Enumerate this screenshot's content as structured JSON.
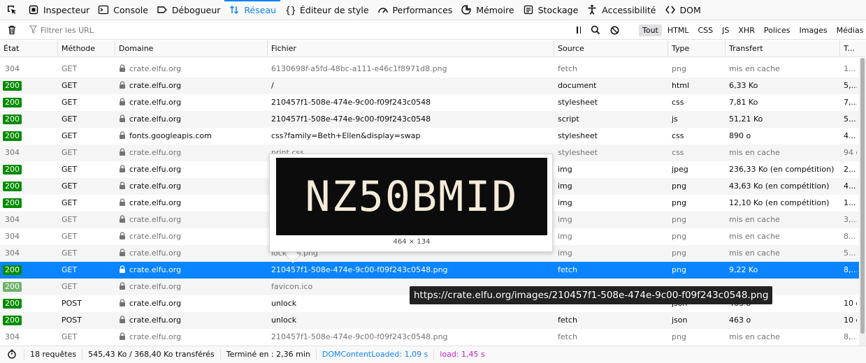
{
  "toolbar": {
    "tabs": [
      {
        "label": "Inspecteur",
        "icon": "inspector-icon"
      },
      {
        "label": "Console",
        "icon": "console-icon"
      },
      {
        "label": "Débogueur",
        "icon": "debugger-icon"
      },
      {
        "label": "Réseau",
        "icon": "network-icon",
        "active": true
      },
      {
        "label": "Éditeur de style",
        "icon": "style-editor-icon"
      },
      {
        "label": "Performances",
        "icon": "performance-icon"
      },
      {
        "label": "Mémoire",
        "icon": "memory-icon"
      },
      {
        "label": "Stockage",
        "icon": "storage-icon"
      },
      {
        "label": "Accessibilité",
        "icon": "accessibility-icon"
      },
      {
        "label": "DOM",
        "icon": "dom-icon"
      }
    ]
  },
  "filter": {
    "placeholder": "Filtrer les URL",
    "types": [
      "Tout",
      "HTML",
      "CSS",
      "JS",
      "XHR",
      "Polices",
      "Images",
      "Médias"
    ],
    "active_type": "Tout"
  },
  "columns": [
    "État",
    "Méthode",
    "Domaine",
    "Fichier",
    "Source",
    "Type",
    "Transfert",
    "T..."
  ],
  "rows": [
    {
      "status": "304",
      "method": "GET",
      "domain": "crate.elfu.org",
      "file": "6130698f-a5fd-48bc-a111-e46c1f8971d8.png",
      "source": "fetch",
      "type": "png",
      "transfer": "mis en cache",
      "size": "1...",
      "cached": true
    },
    {
      "status": "200",
      "method": "GET",
      "domain": "crate.elfu.org",
      "file": "/",
      "source": "document",
      "type": "html",
      "transfer": "6,33 Ko",
      "size": "5,...",
      "cached": false
    },
    {
      "status": "200",
      "method": "GET",
      "domain": "crate.elfu.org",
      "file": "210457f1-508e-474e-9c00-f09f243c0548",
      "source": "stylesheet",
      "type": "css",
      "transfer": "7,81 Ko",
      "size": "7,...",
      "cached": false
    },
    {
      "status": "200",
      "method": "GET",
      "domain": "crate.elfu.org",
      "file": "210457f1-508e-474e-9c00-f09f243c0548",
      "source": "script",
      "type": "js",
      "transfer": "51,21 Ko",
      "size": "5...",
      "cached": false
    },
    {
      "status": "200",
      "method": "GET",
      "domain": "fonts.googleapis.com",
      "file": "css?family=Beth+Ellen&display=swap",
      "source": "stylesheet",
      "type": "css",
      "transfer": "890 o",
      "size": "4...",
      "cached": false
    },
    {
      "status": "304",
      "method": "GET",
      "domain": "crate.elfu.org",
      "file": "print.css",
      "source": "stylesheet",
      "type": "css",
      "transfer": "mis en cache",
      "size": "94 o",
      "cached": true
    },
    {
      "status": "200",
      "method": "GET",
      "domain": "crate.elfu.org",
      "file": "",
      "source": "img",
      "type": "jpeg",
      "transfer": "236,33 Ko (en compétition)",
      "size": "2...",
      "cached": false
    },
    {
      "status": "200",
      "method": "GET",
      "domain": "crate.elfu.org",
      "file": "",
      "source": "img",
      "type": "png",
      "transfer": "43,63 Ko (en compétition)",
      "size": "4...",
      "cached": false
    },
    {
      "status": "200",
      "method": "GET",
      "domain": "crate.elfu.org",
      "file": "",
      "source": "img",
      "type": "png",
      "transfer": "12,10 Ko (en compétition)",
      "size": "1...",
      "cached": false
    },
    {
      "status": "304",
      "method": "GET",
      "domain": "crate.elfu.org",
      "file": "",
      "source": "img",
      "type": "png",
      "transfer": "mis en cache",
      "size": "3,...",
      "cached": true
    },
    {
      "status": "304",
      "method": "GET",
      "domain": "crate.elfu.org",
      "file": "",
      "source": "img",
      "type": "png",
      "transfer": "mis en cache",
      "size": "8...",
      "cached": true
    },
    {
      "status": "304",
      "method": "GET",
      "domain": "crate.elfu.org",
      "file": "lock...el.png",
      "source": "img",
      "type": "png",
      "transfer": "mis en cache",
      "size": "5...",
      "cached": true
    },
    {
      "status": "200",
      "method": "GET",
      "domain": "crate.elfu.org",
      "file": "210457f1-508e-474e-9c00-f09f243c0548.png",
      "source": "fetch",
      "type": "png",
      "transfer": "9,22 Ko",
      "size": "8,...",
      "cached": false,
      "selected": true
    },
    {
      "status": "200",
      "method": "GET",
      "domain": "crate.elfu.org",
      "file": "favicon.ico",
      "source": "",
      "type": "",
      "transfer": "",
      "size": "",
      "cached": true
    },
    {
      "status": "200",
      "method": "POST",
      "domain": "crate.elfu.org",
      "file": "unlock",
      "source": "",
      "type": "json",
      "transfer": "463 o",
      "size": "10 o",
      "cached": false
    },
    {
      "status": "200",
      "method": "POST",
      "domain": "crate.elfu.org",
      "file": "unlock",
      "source": "fetch",
      "type": "json",
      "transfer": "463 o",
      "size": "10 o",
      "cached": false
    },
    {
      "status": "304",
      "method": "GET",
      "domain": "crate.elfu.org",
      "file": "210457f1-508e-474e-9c00-f09f243c0548.png",
      "source": "fetch",
      "type": "png",
      "transfer": "mis en cache",
      "size": "8,...",
      "cached": true
    }
  ],
  "footer": {
    "requests": "18 requêtes",
    "transferred": "545,43 Ko / 368,40 Ko transférés",
    "finished": "Terminé en : 2,36 min",
    "dom_loaded": "DOMContentLoaded: 1,09 s",
    "load": "load: 1,45 s"
  },
  "preview": {
    "image_text": "NZ50BMID",
    "dimensions": "464 × 134"
  },
  "url_tooltip": "https://crate.elfu.org/images/210457f1-508e-474e-9c00-f09f243c0548.png",
  "colors": {
    "accent": "#0a84ff",
    "status_ok": "#058b00",
    "dom_loaded": "#0a84ff",
    "load": "#c51ec5"
  }
}
